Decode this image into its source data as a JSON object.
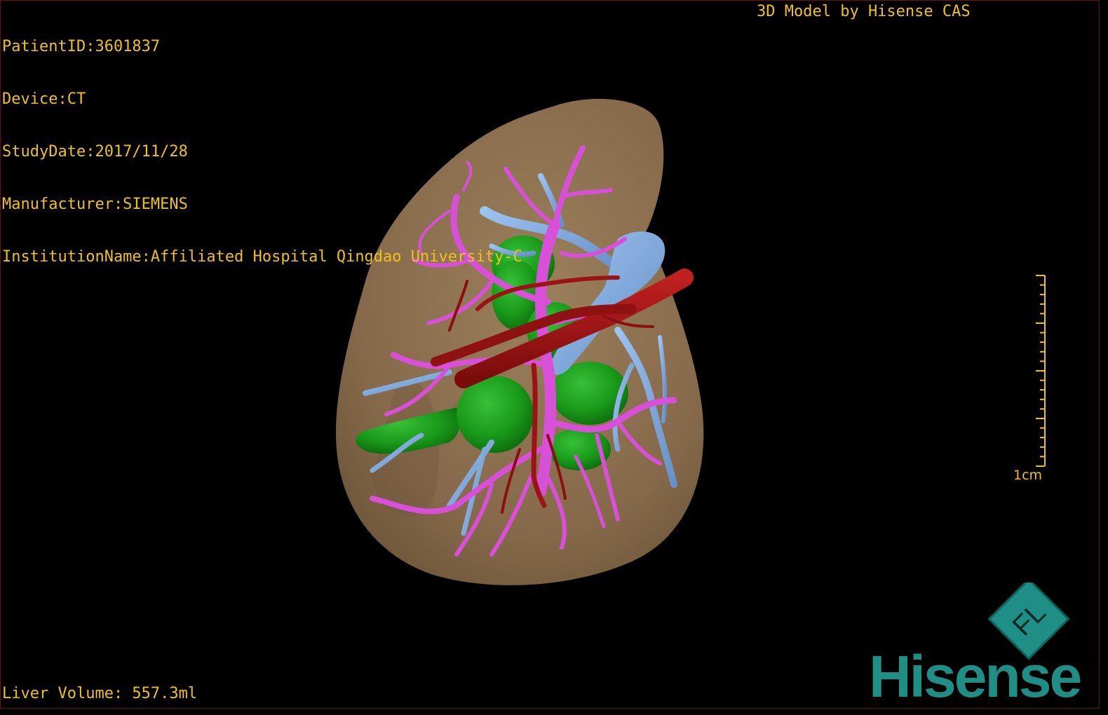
{
  "patient_info": {
    "patient_id": "PatientID:3601837",
    "device": "Device:CT",
    "study_date": "StudyDate:2017/11/28",
    "manufacturer": "Manufacturer:SIEMENS",
    "institution": "InstitutionName:Affiliated Hospital Qingdao University-C"
  },
  "model_credit": "3D Model by Hisense CAS",
  "liver_volume": "Liver Volume: 557.3ml",
  "scale": {
    "label": "1cm"
  },
  "logo": {
    "cube_letters": "FL",
    "brand": "Hisense"
  },
  "colors": {
    "overlay_text": "#f0c020",
    "liver_surface": "#8b7150",
    "portal_vein": "#d850d8",
    "hepatic_vein": "#7aa6dc",
    "artery": "#a01414",
    "lesion": "#1c9e1c",
    "brand": "#1f8f86",
    "background": "#000000"
  }
}
